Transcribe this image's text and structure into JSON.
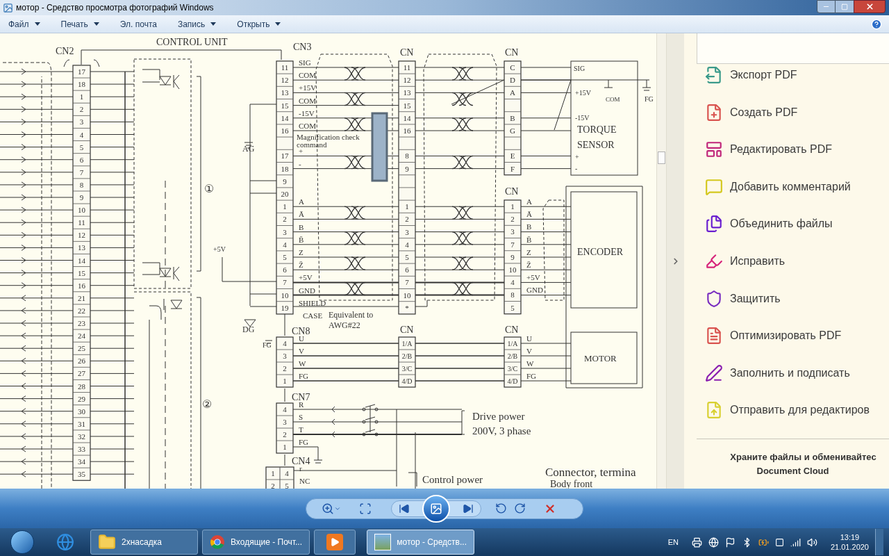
{
  "window": {
    "title": "мотор - Средство просмотра фотографий Windows"
  },
  "menu": [
    {
      "label": "Файл",
      "dropdown": true
    },
    {
      "label": "Печать",
      "dropdown": true
    },
    {
      "label": "Эл. почта",
      "dropdown": false
    },
    {
      "label": "Запись",
      "dropdown": true
    },
    {
      "label": "Открыть",
      "dropdown": true
    }
  ],
  "diagram": {
    "connectors": [
      {
        "label": "CN2",
        "pins": [
          "17",
          "18",
          "1",
          "2",
          "3",
          "4",
          "5",
          "6",
          "7",
          "8",
          "9",
          "10",
          "11",
          "12",
          "13",
          "14",
          "15",
          "16",
          "21",
          "22",
          "23",
          "24",
          "25",
          "26",
          "27",
          "28",
          "29",
          "30",
          "31",
          "32",
          "33",
          "34",
          "35"
        ]
      },
      {
        "label": "CN3",
        "pins": [
          {
            "label": "11",
            "signal": "SIG"
          },
          {
            "label": "12",
            "signal": "COM"
          },
          {
            "label": "13",
            "signal": "+15V"
          },
          {
            "label": "15",
            "signal": "COM"
          },
          {
            "label": "14",
            "signal": "-15V"
          },
          {
            "label": "16",
            "signal": "COM"
          },
          {
            "kind": "empty"
          },
          {
            "label": "17",
            "signal": "+"
          },
          {
            "label": "18",
            "signal": "-"
          },
          {
            "label": "9"
          },
          {
            "label": "20"
          },
          {
            "label": "1",
            "signal": "A"
          },
          {
            "label": "2",
            "signal": "Ā"
          },
          {
            "label": "3",
            "signal": "B"
          },
          {
            "label": "4",
            "signal": "B̄"
          },
          {
            "label": "5",
            "signal": "Z"
          },
          {
            "label": "6",
            "signal": "Z̄"
          },
          {
            "label": "7",
            "signal": "+5V"
          },
          {
            "label": "10",
            "signal": "GND"
          },
          {
            "label": "19",
            "signal": "SHIELD"
          }
        ]
      },
      {
        "label": "CN",
        "pins": [
          "11",
          "12",
          "13",
          "15",
          "14",
          "16",
          {
            "kind": "empty"
          },
          "8",
          "9",
          {
            "kind": "empty"
          },
          {
            "kind": "empty"
          },
          "1",
          "2",
          "3",
          "4",
          "5",
          "6",
          "7",
          "10",
          "*"
        ]
      },
      {
        "label": "CN",
        "pins": [
          "C",
          "D",
          "A",
          {
            "kind": "empty"
          },
          "B",
          "G",
          {
            "kind": "empty"
          },
          "E",
          "F"
        ]
      },
      {
        "label": "CN",
        "pins": [
          "1",
          "2",
          "3",
          "7",
          "9",
          "10",
          "4",
          "8",
          "5"
        ],
        "signals": [
          "A",
          "Ā",
          "B",
          "B̄",
          "Z",
          "Z̄",
          "+5V",
          "GND"
        ]
      },
      {
        "label": "CN8",
        "pins": [
          "4",
          "3",
          "2",
          "1"
        ],
        "signals": [
          "U",
          "V",
          "W",
          "FG"
        ]
      },
      {
        "label": "CN",
        "pins": [
          "1/A",
          "2/B",
          "3/C",
          "4/D"
        ]
      },
      {
        "label": "CN",
        "pins": [
          "1/A",
          "2/B",
          "3/C",
          "4/D"
        ],
        "signals": [
          "U",
          "V",
          "W",
          "FG"
        ]
      },
      {
        "label": "CN7",
        "pins": [
          "4",
          "3",
          "2",
          "1"
        ],
        "signals": [
          "R",
          "S",
          "T",
          "FG"
        ]
      },
      {
        "label": "CN4",
        "pins": [
          "1",
          "4",
          "2",
          "5"
        ],
        "signals": [
          "r",
          "NC"
        ]
      }
    ],
    "labels": [
      "CONTROL UNIT",
      "①",
      "②",
      "AG",
      "+5V",
      "DG",
      "FG",
      "Magnification check",
      "command",
      "CASE",
      "Equivalent to",
      "AWG#22",
      "SIG",
      "+15V",
      "COM",
      "-15V",
      "TORQUE",
      "SENSOR",
      "+",
      "-",
      "FG",
      "ENCODER",
      "MOTOR",
      "Drive power",
      "200V, 3 phase",
      "Control power",
      "Connector, termina",
      "Body front"
    ]
  },
  "tools": [
    {
      "kind": "export",
      "label": "Экспорт PDF",
      "color": "#3a9a8a"
    },
    {
      "kind": "create",
      "label": "Создать PDF",
      "color": "#d9534f"
    },
    {
      "kind": "edit",
      "label": "Редактировать PDF",
      "color": "#c0267a"
    },
    {
      "kind": "comment",
      "label": "Добавить комментарий",
      "color": "#d4c81e"
    },
    {
      "kind": "combine",
      "label": "Объединить файлы",
      "color": "#6a1fd0"
    },
    {
      "kind": "redact",
      "label": "Исправить",
      "color": "#d6247a"
    },
    {
      "kind": "protect",
      "label": "Защитить",
      "color": "#7a2fc0"
    },
    {
      "kind": "optimize",
      "label": "Оптимизировать PDF",
      "color": "#d9534f"
    },
    {
      "kind": "sign",
      "label": "Заполнить и подписать",
      "color": "#8a1fb0"
    },
    {
      "kind": "send",
      "label": "Отправить для редактиров",
      "color": "#d8d030"
    }
  ],
  "cloud_promo": [
    "Храните файлы и обменивайтес",
    "Document Cloud"
  ],
  "taskbar": [
    {
      "kind": "folder",
      "label": "2хнасадка",
      "selected": false
    },
    {
      "kind": "browser",
      "label": "Входящие - Почт...",
      "selected": false
    },
    {
      "kind": "player",
      "selected": false
    },
    {
      "kind": "viewer",
      "label": "мотор - Средств...",
      "selected": true
    }
  ],
  "tray": {
    "language": "EN",
    "time": "13:19",
    "date": "21.01.2020"
  }
}
